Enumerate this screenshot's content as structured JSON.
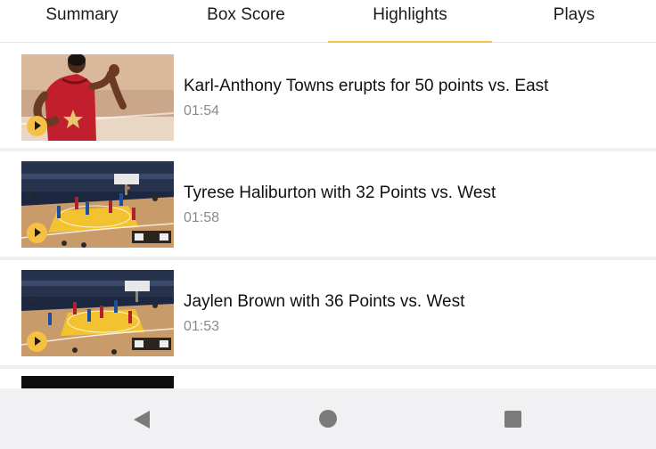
{
  "tabs": [
    {
      "label": "Summary",
      "active": false
    },
    {
      "label": "Box Score",
      "active": false
    },
    {
      "label": "Highlights",
      "active": true
    },
    {
      "label": "Plays",
      "active": false
    }
  ],
  "colors": {
    "accent": "#f5c044",
    "duration_text": "#8a8a8a",
    "nav_icon": "#7a7a7a"
  },
  "highlights": [
    {
      "title": "Karl-Anthony Towns erupts for 50 points vs. East",
      "duration": "01:54",
      "thumbnail": "player-jersey-thumbnail",
      "badge_icon": "play-icon"
    },
    {
      "title": "Tyrese Haliburton with 32 Points vs. West",
      "duration": "01:58",
      "thumbnail": "court-thumbnail",
      "badge_icon": "play-icon"
    },
    {
      "title": "Jaylen Brown with 36 Points vs. West",
      "duration": "01:53",
      "thumbnail": "court-thumbnail",
      "badge_icon": "play-icon"
    }
  ],
  "navbar": {
    "back_icon": "back-triangle-icon",
    "home_icon": "home-circle-icon",
    "recents_icon": "recents-square-icon"
  }
}
